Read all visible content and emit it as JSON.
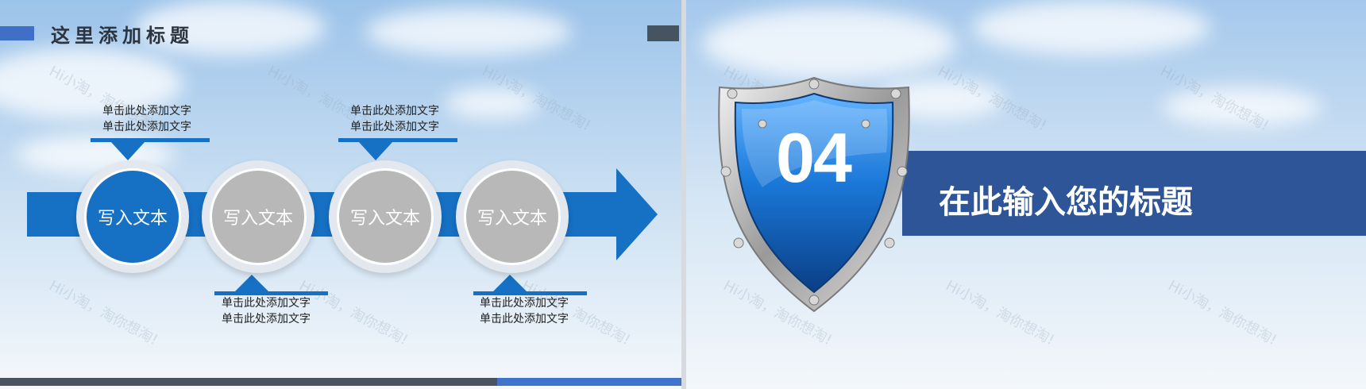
{
  "left_slide": {
    "header_title": "这里添加标题",
    "steps": [
      {
        "label": "写入文本",
        "style": "blue"
      },
      {
        "label": "写入文本",
        "style": "gray"
      },
      {
        "label": "写入文本",
        "style": "gray"
      },
      {
        "label": "写入文本",
        "style": "gray"
      }
    ],
    "notes_top": [
      {
        "line1": "单击此处添加文字",
        "line2": "单击此处添加文字"
      },
      {
        "line1": "单击此处添加文字",
        "line2": "单击此处添加文字"
      }
    ],
    "notes_bottom": [
      {
        "line1": "单击此处添加文字",
        "line2": "单击此处添加文字"
      },
      {
        "line1": "单击此处添加文字",
        "line2": "单击此处添加文字"
      }
    ]
  },
  "right_slide": {
    "section_number": "04",
    "section_title": "在此输入您的标题"
  },
  "watermark_text": "Hi小淘，淘你想淘!",
  "colors": {
    "accent_blue": "#1670c4",
    "band_blue": "#2e5598",
    "header_accent": "#3f6fc6",
    "dark_gray": "#465462"
  }
}
